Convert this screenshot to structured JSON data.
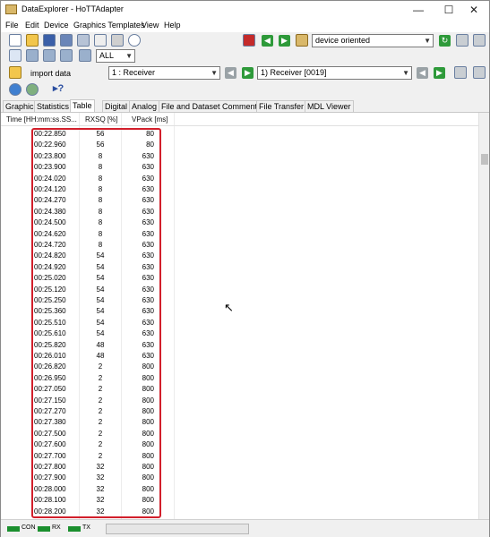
{
  "window": {
    "title": "DataExplorer - HoTTAdapter",
    "controls": {
      "minimize": "—",
      "maximize": "☐",
      "close": "✕"
    }
  },
  "menu": [
    "File",
    "Edit",
    "Device",
    "Graphics Templates",
    "View",
    "Help"
  ],
  "toolbar": {
    "filter_value": "ALL",
    "device_mode": "device oriented",
    "import_label": "import data",
    "channel": "1 : Receiver",
    "record_set": "1) Receiver [0019]"
  },
  "tabs": [
    {
      "label": "Graphic",
      "active": false
    },
    {
      "label": "Statistics",
      "active": false
    },
    {
      "label": "Table",
      "active": true
    },
    {
      "label": "Digital",
      "active": false
    },
    {
      "label": "Analog",
      "active": false
    },
    {
      "label": "File and Dataset Comment",
      "active": false
    },
    {
      "label": "File Transfer",
      "active": false
    },
    {
      "label": "MDL Viewer",
      "active": false
    }
  ],
  "table": {
    "headers": [
      "Time [HH:mm:ss.SS...",
      "RXSQ [%]",
      "VPack [ms]"
    ],
    "rows": [
      [
        "00:22.850",
        "56",
        "80"
      ],
      [
        "00:22.960",
        "56",
        "80"
      ],
      [
        "00:23.800",
        "8",
        "630"
      ],
      [
        "00:23.900",
        "8",
        "630"
      ],
      [
        "00:24.020",
        "8",
        "630"
      ],
      [
        "00:24.120",
        "8",
        "630"
      ],
      [
        "00:24.270",
        "8",
        "630"
      ],
      [
        "00:24.380",
        "8",
        "630"
      ],
      [
        "00:24.500",
        "8",
        "630"
      ],
      [
        "00:24.620",
        "8",
        "630"
      ],
      [
        "00:24.720",
        "8",
        "630"
      ],
      [
        "00:24.820",
        "54",
        "630"
      ],
      [
        "00:24.920",
        "54",
        "630"
      ],
      [
        "00:25.020",
        "54",
        "630"
      ],
      [
        "00:25.120",
        "54",
        "630"
      ],
      [
        "00:25.250",
        "54",
        "630"
      ],
      [
        "00:25.360",
        "54",
        "630"
      ],
      [
        "00:25.510",
        "54",
        "630"
      ],
      [
        "00:25.610",
        "54",
        "630"
      ],
      [
        "00:25.820",
        "48",
        "630"
      ],
      [
        "00:26.010",
        "48",
        "630"
      ],
      [
        "00:26.820",
        "2",
        "800"
      ],
      [
        "00:26.950",
        "2",
        "800"
      ],
      [
        "00:27.050",
        "2",
        "800"
      ],
      [
        "00:27.150",
        "2",
        "800"
      ],
      [
        "00:27.270",
        "2",
        "800"
      ],
      [
        "00:27.380",
        "2",
        "800"
      ],
      [
        "00:27.500",
        "2",
        "800"
      ],
      [
        "00:27.600",
        "2",
        "800"
      ],
      [
        "00:27.700",
        "2",
        "800"
      ],
      [
        "00:27.800",
        "32",
        "800"
      ],
      [
        "00:27.900",
        "32",
        "800"
      ],
      [
        "00:28.000",
        "32",
        "800"
      ],
      [
        "00:28.100",
        "32",
        "800"
      ],
      [
        "00:28.200",
        "32",
        "800"
      ]
    ]
  },
  "status": {
    "con": "CON",
    "rx": "RX",
    "tx": "TX",
    "led_color": "#1b8f2e"
  },
  "highlight_color": "#d21f2b"
}
